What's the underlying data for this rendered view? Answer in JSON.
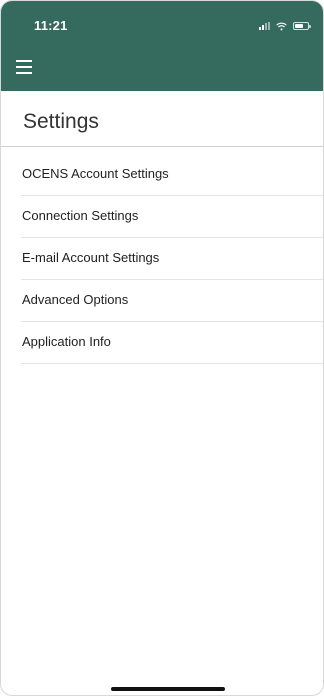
{
  "status_bar": {
    "time": "11:21",
    "icons": [
      "signal-icon",
      "wifi-icon",
      "battery-icon"
    ]
  },
  "header": {
    "background_color": "#356a5f",
    "menu_icon": "menu-icon"
  },
  "page": {
    "title": "Settings"
  },
  "settings_items": [
    {
      "label": "OCENS Account Settings"
    },
    {
      "label": "Connection Settings"
    },
    {
      "label": "E-mail Account Settings"
    },
    {
      "label": "Advanced Options"
    },
    {
      "label": "Application Info"
    }
  ]
}
